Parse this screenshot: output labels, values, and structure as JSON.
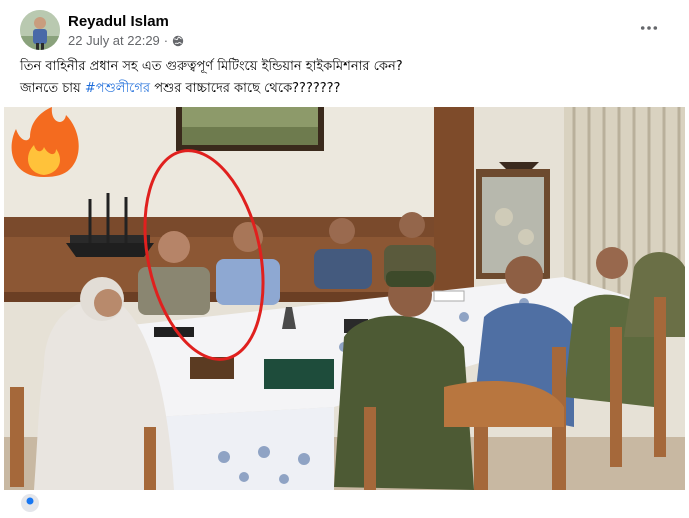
{
  "post": {
    "author": "Reyadul Islam",
    "date": "22 July at 22:29",
    "separator": "·",
    "line1": "তিন বাহিনীর প্রধান সহ এত গুরুত্বপূর্ণ মিটিংয়ে ইন্ডিয়ান হাইকমিশনার কেন?",
    "line2_prefix": "জানতে চায় ",
    "hashtag": "#পশুলীগের",
    "line2_suffix": " পশুর বাচ্চাদের কাছে থেকে???????"
  },
  "icons": {
    "more": "more-dots-icon",
    "privacy": "globe-icon",
    "reaction": "fire-emoji-icon"
  },
  "colors": {
    "author": "#050505",
    "meta": "#65676b",
    "hashtag": "#216fdb",
    "annotation": "#e0201e"
  }
}
